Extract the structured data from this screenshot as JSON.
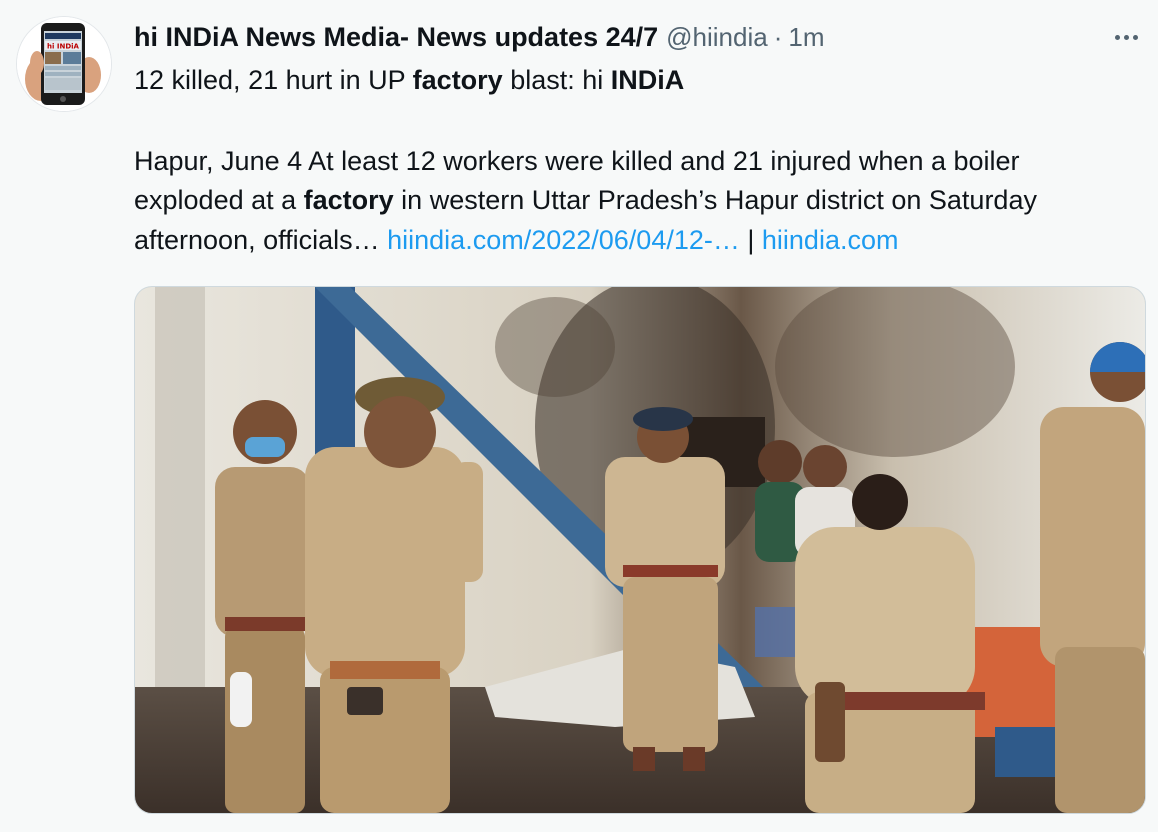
{
  "tweet": {
    "display_name": "hi INDiA News Media- News updates 24/7",
    "handle": "@hiindia",
    "separator": "·",
    "time": "1m",
    "headline": {
      "p1": "12 killed, 21 hurt in UP ",
      "b1": "factory",
      "p2": " blast: hi ",
      "b2": "INDiA"
    },
    "body": {
      "line1": "Hapur, June 4 At least 12 workers were killed and 21 injured when a boiler",
      "line2_pre": "exploded at a ",
      "line2_bold": "factory",
      "line2_post": " in western Uttar Pradesh’s Hapur district on Saturday",
      "line3_pre": "afternoon, officials… ",
      "link1": "hiindia.com/2022/06/04/12-…",
      "sep": " | ",
      "link2": "hiindia.com"
    },
    "avatar_text": "hi INDiA"
  },
  "colors": {
    "background": "#f7f9f9",
    "text": "#0f1419",
    "muted": "#536471",
    "link": "#1d9bf0"
  },
  "icons": {
    "more": "more-horizontal-icon"
  }
}
